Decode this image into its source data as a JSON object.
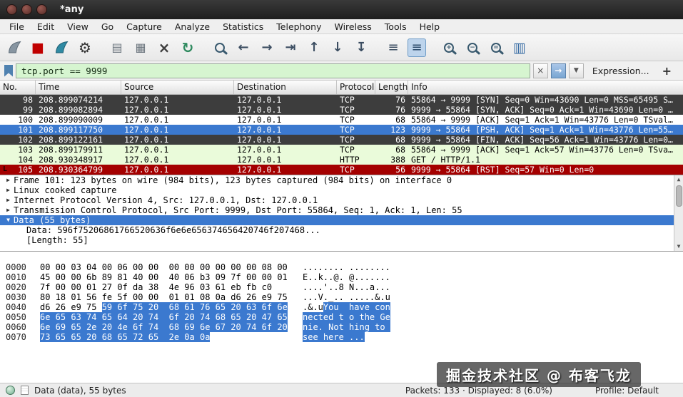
{
  "window": {
    "title": "*any"
  },
  "colors": {
    "accent": "#3b79cf",
    "row_dark": "#3d3d3d",
    "row_pale": "#eafbda",
    "row_red": "#a40000",
    "filter_bg": "#d6f5d0"
  },
  "menu": {
    "items": [
      "File",
      "Edit",
      "View",
      "Go",
      "Capture",
      "Analyze",
      "Statistics",
      "Telephony",
      "Wireless",
      "Tools",
      "Help"
    ]
  },
  "toolbar": {
    "icons": [
      {
        "name": "start-capture-icon",
        "type": "fin-gray"
      },
      {
        "name": "stop-capture-icon",
        "glyph": "■"
      },
      {
        "name": "restart-capture-icon",
        "type": "fin-teal"
      },
      {
        "name": "capture-options-icon",
        "glyph": "⚙"
      },
      {
        "name": "open-file-icon",
        "glyph": "▤"
      },
      {
        "name": "save-file-icon",
        "glyph": "▦"
      },
      {
        "name": "close-file-icon",
        "glyph": "×"
      },
      {
        "name": "reload-icon",
        "glyph": "↻"
      },
      {
        "name": "find-packet-icon",
        "type": "mag",
        "sign": ""
      },
      {
        "name": "go-back-icon",
        "glyph": "←"
      },
      {
        "name": "go-forward-icon",
        "glyph": "→"
      },
      {
        "name": "go-to-packet-icon",
        "glyph": "⇥"
      },
      {
        "name": "go-first-icon",
        "glyph": "↑"
      },
      {
        "name": "go-last-icon",
        "glyph": "↓"
      },
      {
        "name": "autoscroll-icon",
        "glyph": "↧"
      },
      {
        "name": "colorize-icon",
        "glyph": "≡"
      },
      {
        "name": "auto-scroll-live-icon",
        "glyph": "≡"
      },
      {
        "name": "zoom-in-icon",
        "type": "mag",
        "sign": "+"
      },
      {
        "name": "zoom-out-icon",
        "type": "mag",
        "sign": "−"
      },
      {
        "name": "zoom-normal-icon",
        "type": "mag",
        "sign": "="
      },
      {
        "name": "resize-columns-icon",
        "glyph": "▥"
      }
    ]
  },
  "filter": {
    "value": "tcp.port == 9999",
    "clear_glyph": "×",
    "apply_glyph": "→",
    "dropdown_glyph": "▼",
    "expression_label": "Expression...",
    "add_label": "+"
  },
  "packet_list": {
    "columns": [
      "No.",
      "Time",
      "Source",
      "Destination",
      "Protocol",
      "Length",
      "Info"
    ],
    "rows": [
      {
        "marker": "",
        "no": "98",
        "time": "208.899074214",
        "src": "127.0.0.1",
        "dst": "127.0.0.1",
        "proto": "TCP",
        "len": "76",
        "info": "55864 → 9999 [SYN] Seq=0 Win=43690 Len=0 MSS=65495 S…",
        "style": "dark"
      },
      {
        "marker": "",
        "no": "99",
        "time": "208.899082894",
        "src": "127.0.0.1",
        "dst": "127.0.0.1",
        "proto": "TCP",
        "len": "76",
        "info": "9999 → 55864 [SYN, ACK] Seq=0 Ack=1 Win=43690 Len=0 …",
        "style": "dark"
      },
      {
        "marker": "",
        "no": "100",
        "time": "208.899090009",
        "src": "127.0.0.1",
        "dst": "127.0.0.1",
        "proto": "TCP",
        "len": "68",
        "info": "55864 → 9999 [ACK] Seq=1 Ack=1 Win=43776 Len=0 TSval…",
        "style": "white"
      },
      {
        "marker": "",
        "no": "101",
        "time": "208.899117750",
        "src": "127.0.0.1",
        "dst": "127.0.0.1",
        "proto": "TCP",
        "len": "123",
        "info": "9999 → 55864 [PSH, ACK] Seq=1 Ack=1 Win=43776 Len=55…",
        "style": "selected"
      },
      {
        "marker": "",
        "no": "102",
        "time": "208.899122161",
        "src": "127.0.0.1",
        "dst": "127.0.0.1",
        "proto": "TCP",
        "len": "68",
        "info": "9999 → 55864 [FIN, ACK] Seq=56 Ack=1 Win=43776 Len=0…",
        "style": "dark"
      },
      {
        "marker": "",
        "no": "103",
        "time": "208.899179911",
        "src": "127.0.0.1",
        "dst": "127.0.0.1",
        "proto": "TCP",
        "len": "68",
        "info": "55864 → 9999 [ACK] Seq=1 Ack=57 Win=43776 Len=0 TSva…",
        "style": "pale"
      },
      {
        "marker": "",
        "no": "104",
        "time": "208.930348917",
        "src": "127.0.0.1",
        "dst": "127.0.0.1",
        "proto": "HTTP",
        "len": "388",
        "info": "GET / HTTP/1.1",
        "style": "pale"
      },
      {
        "marker": "L",
        "no": "105",
        "time": "208.930364799",
        "src": "127.0.0.1",
        "dst": "127.0.0.1",
        "proto": "TCP",
        "len": "56",
        "info": "9999 → 55864 [RST] Seq=57 Win=0 Len=0",
        "style": "red"
      }
    ]
  },
  "details": {
    "lines": [
      {
        "marker": "▶",
        "text": "Frame 101: 123 bytes on wire (984 bits), 123 bytes captured (984 bits) on interface 0",
        "style": "normal"
      },
      {
        "marker": "▶",
        "text": "Linux cooked capture",
        "style": "normal"
      },
      {
        "marker": "▶",
        "text": "Internet Protocol Version 4, Src: 127.0.0.1, Dst: 127.0.0.1",
        "style": "normal"
      },
      {
        "marker": "▶",
        "text": "Transmission Control Protocol, Src Port: 9999, Dst Port: 55864, Seq: 1, Ack: 1, Len: 55",
        "style": "normal"
      },
      {
        "marker": "▼",
        "text": "Data (55 bytes)",
        "style": "selected"
      },
      {
        "marker": "",
        "text": "Data: 596f75206861766520636f6e6e656374656420746f207468...",
        "style": "child"
      },
      {
        "marker": "",
        "text": "[Length: 55]",
        "style": "child"
      }
    ],
    "scrollbar": {
      "up": "▲",
      "down": "▼"
    }
  },
  "hex": {
    "rows": [
      {
        "off": "0000",
        "h1": "00 00 03 04 00 06 00 00  00 00 00 00 00 00 08 00",
        "h2": "",
        "a1": "........ ........",
        "a2": ""
      },
      {
        "off": "0010",
        "h1": "45 00 00 6b 89 81 40 00  40 06 b3 09 7f 00 00 01",
        "h2": "",
        "a1": "E..k..@. @.......",
        "a2": ""
      },
      {
        "off": "0020",
        "h1": "7f 00 00 01 27 0f da 38  4e 96 03 61 eb fb c0",
        "h2": "",
        "a1": "....'..8 N...a...",
        "a2": ""
      },
      {
        "off": "0030",
        "h1": "80 18 01 56 fe 5f 00 00  01 01 08 0a d6 26 e9 75",
        "h2": "",
        "a1": "...V._.. .....&.u",
        "a2": ""
      },
      {
        "off": "0040",
        "h1": "d6 26 e9 75 ",
        "h2": "59 6f 75 20  68 61 76 65 20 63 6f 6e",
        "a1": ".&.u",
        "a2": "You  have con"
      },
      {
        "off": "0050",
        "h1": "",
        "h2": "6e 65 63 74 65 64 20 74  6f 20 74 68 65 20 47 65",
        "a1": "",
        "a2": "nected t o the Ge"
      },
      {
        "off": "0060",
        "h1": "",
        "h2": "6e 69 65 2e 20 4e 6f 74  68 69 6e 67 20 74 6f 20",
        "a1": "",
        "a2": "nie. Not hing to "
      },
      {
        "off": "0070",
        "h1": "",
        "h2": "73 65 65 20 68 65 72 65  2e 0a 0a",
        "a1": "",
        "a2": "see here ..."
      }
    ]
  },
  "status": {
    "field_info": "Data (data), 55 bytes",
    "packets_info": "Packets: 133 · Displayed: 8 (6.0%)",
    "profile": "Profile: Default"
  },
  "watermark": {
    "text": "掘金技术社区 @ 布客飞龙"
  }
}
